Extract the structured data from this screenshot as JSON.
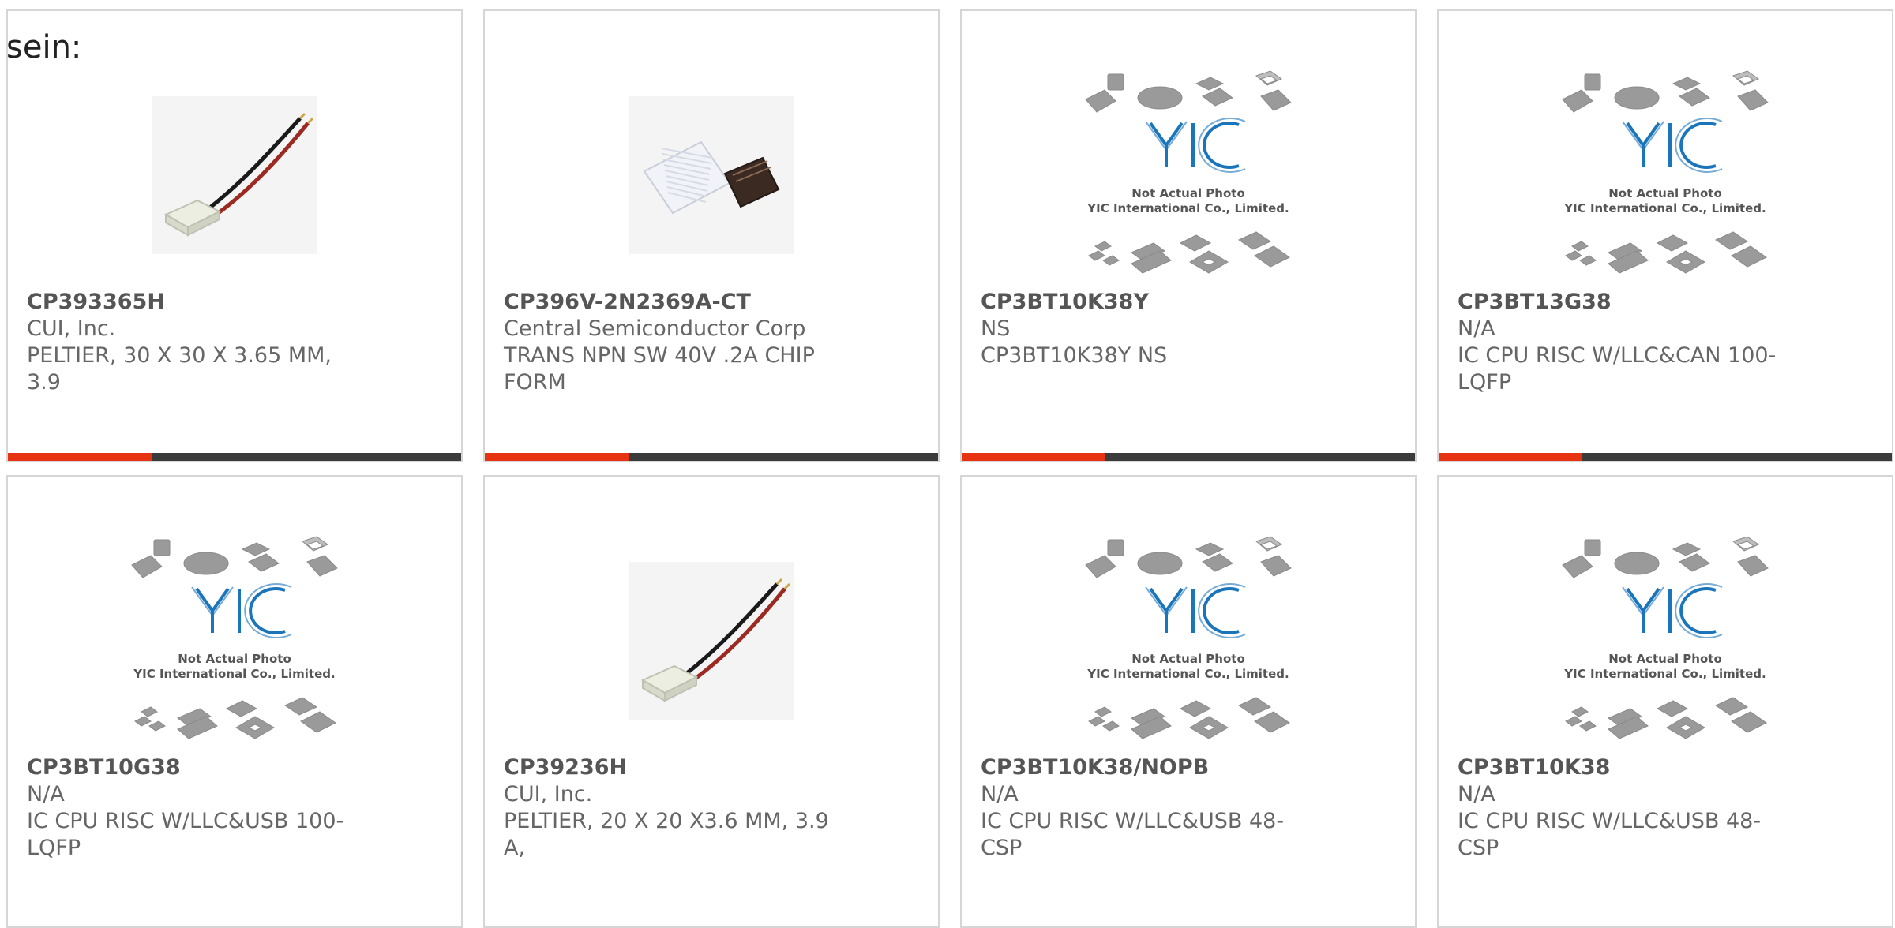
{
  "intro_text": "sein:",
  "colors": {
    "accent": "#e63312",
    "bar_dark": "#3b3b3b",
    "part_number": "#555555",
    "text": "#666666",
    "logo_blue": "#1b75bb"
  },
  "placeholder": {
    "line1": "Not Actual Photo",
    "line2": "YIC International Co., Limited."
  },
  "products": [
    {
      "part_number": "CP393365H",
      "manufacturer": "CUI, Inc.",
      "description": "PELTIER, 30 X 30 X 3.65 MM, 3.9",
      "image": "peltier-module-photo",
      "has_bar": true
    },
    {
      "part_number": "CP396V-2N2369A-CT",
      "manufacturer": "Central Semiconductor Corp",
      "description": "TRANS NPN SW 40V .2A CHIP FORM",
      "image": "chip-die-photo",
      "has_bar": true
    },
    {
      "part_number": "CP3BT10K38Y",
      "manufacturer": "NS",
      "description": "CP3BT10K38Y NS",
      "image": "yic-placeholder",
      "has_bar": true
    },
    {
      "part_number": "CP3BT13G38",
      "manufacturer": "N/A",
      "description": "IC CPU RISC W/LLC&CAN 100-LQFP",
      "image": "yic-placeholder",
      "has_bar": true
    },
    {
      "part_number": "CP3BT10G38",
      "manufacturer": "N/A",
      "description": "IC CPU RISC W/LLC&USB 100-LQFP",
      "image": "yic-placeholder",
      "has_bar": false
    },
    {
      "part_number": "CP39236H",
      "manufacturer": "CUI, Inc.",
      "description": "PELTIER, 20 X 20 X3.6 MM, 3.9 A,",
      "image": "peltier-module-photo",
      "has_bar": false
    },
    {
      "part_number": "CP3BT10K38/NOPB",
      "manufacturer": "N/A",
      "description": "IC CPU RISC W/LLC&USB 48-CSP",
      "image": "yic-placeholder",
      "has_bar": false
    },
    {
      "part_number": "CP3BT10K38",
      "manufacturer": "N/A",
      "description": "IC CPU RISC W/LLC&USB 48-CSP",
      "image": "yic-placeholder",
      "has_bar": false
    }
  ]
}
